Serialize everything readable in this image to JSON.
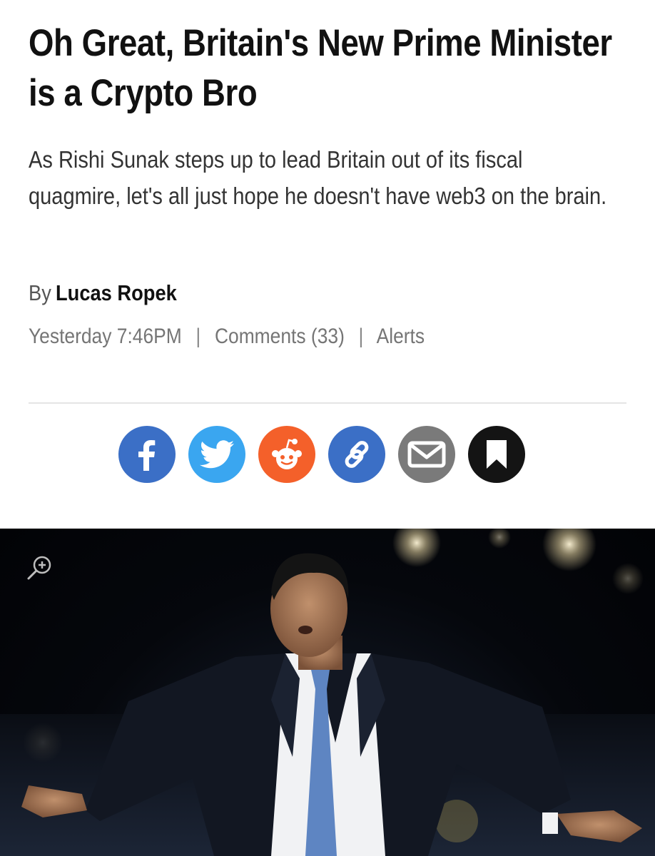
{
  "article": {
    "headline": "Oh Great, Britain's New Prime Minister is a Crypto Bro",
    "dek": "As Rishi Sunak steps up to lead Britain out of its fiscal quagmire, let's all just hope he doesn't have web3 on the brain.",
    "byline_prefix": "By",
    "author": "Lucas Ropek",
    "timestamp": "Yesterday 7:46PM",
    "separator": "|",
    "comments": "Comments (33)",
    "alerts": "Alerts"
  },
  "share_buttons": [
    {
      "name": "facebook",
      "icon": "facebook-icon",
      "color": "#3b6fc6"
    },
    {
      "name": "twitter",
      "icon": "twitter-icon",
      "color": "#3aa6f0"
    },
    {
      "name": "reddit",
      "icon": "reddit-icon",
      "color": "#f4602a"
    },
    {
      "name": "copy-link",
      "icon": "link-icon",
      "color": "#3b6fc6"
    },
    {
      "name": "email",
      "icon": "mail-icon",
      "color": "#7a7a7a"
    },
    {
      "name": "save",
      "icon": "bookmark-icon",
      "color": "#141414"
    }
  ],
  "hero_image": {
    "zoom_icon": "zoom-in-icon",
    "subject": "man in dark suit and blue tie speaking on stage with arms outstretched"
  }
}
